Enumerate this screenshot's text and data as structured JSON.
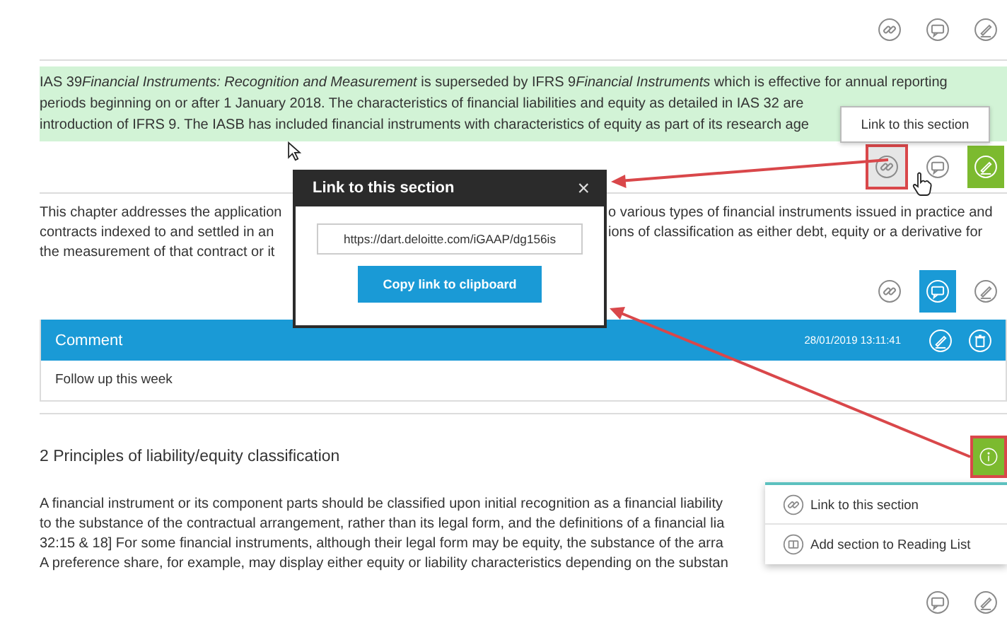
{
  "sections": [
    {
      "kind": "actions",
      "actions": [
        {
          "kind": "link",
          "active": false,
          "marked": false
        },
        {
          "kind": "comment",
          "active": false,
          "marked": false
        },
        {
          "kind": "edit",
          "active": false,
          "marked": false
        }
      ]
    },
    {
      "kind": "divider"
    },
    {
      "kind": "paragraph",
      "highlighted": true,
      "lines": [
        [
          {
            "text": "IAS 39",
            "italic": false
          },
          {
            "text": "Financial Instruments: Recognition and Measurement",
            "italic": true
          },
          {
            "text": " is superseded by IFRS 9",
            "italic": false
          },
          {
            "text": "Financial Instruments",
            "italic": true
          },
          {
            "text": " which is effective for annual reporting",
            "italic": false
          }
        ],
        "periods beginning on or after 1 January 2018. The characteristics of financial liabilities and equity as detailed in IAS 32 are",
        "introduction of IFRS 9. The IASB has included financial instruments with characteristics of equity as part of its research age"
      ]
    },
    {
      "kind": "actions",
      "actions": [
        {
          "kind": "link",
          "active": false,
          "marked": true
        },
        {
          "kind": "comment",
          "active": false,
          "marked": false
        },
        {
          "kind": "edit",
          "active": true,
          "marked": false
        }
      ]
    },
    {
      "kind": "divider"
    },
    {
      "kind": "paragraph",
      "highlighted": false,
      "lines": [
        "This chapter addresses the application",
        "contracts indexed to and settled in an",
        "the measurement of that contract or it"
      ],
      "lines_right": [
        "o various types of financial instruments issued in practice and",
        "ions of classification as either debt, equity or a derivative for"
      ]
    },
    {
      "kind": "actions",
      "actions": [
        {
          "kind": "link",
          "active": false,
          "marked": false
        },
        {
          "kind": "comment",
          "active": true,
          "marked": false
        },
        {
          "kind": "edit",
          "active": false,
          "marked": false
        }
      ]
    },
    {
      "kind": "comment",
      "title": "Comment",
      "date": "28/01/2019 13:11:41",
      "text": "Follow up this week"
    },
    {
      "kind": "divider"
    },
    {
      "kind": "heading",
      "text": "2 Principles of liability/equity classification",
      "actions": [
        {
          "kind": "info",
          "active": true,
          "marked": true
        }
      ]
    },
    {
      "kind": "paragraph",
      "highlighted": false,
      "lines": [
        "A financial instrument or its component parts should be classified upon initial recognition as a financial liability",
        "to the substance of the contractual arrangement, rather than its legal form, and the definitions of a financial lia",
        "32:15 & 18] For some financial instruments, although their legal form may be equity, the substance of the arra",
        "A preference share, for example, may display either equity or liability characteristics depending on the substan"
      ]
    },
    {
      "kind": "actions",
      "actions": [
        {
          "kind": "comment",
          "active": false,
          "marked": false
        },
        {
          "kind": "edit",
          "active": false,
          "marked": false
        }
      ]
    }
  ],
  "tooltip": {
    "text": "Link to this section"
  },
  "popup": {
    "title": "Link to this section",
    "close": "×",
    "url": "https://dart.deloitte.com/iGAAP/dg156is",
    "button": "Copy link to clipboard"
  },
  "menu": {
    "items": [
      {
        "kind": "link",
        "label": "Link to this section"
      },
      {
        "kind": "reading-list",
        "label": "Add section to Reading List"
      }
    ]
  }
}
